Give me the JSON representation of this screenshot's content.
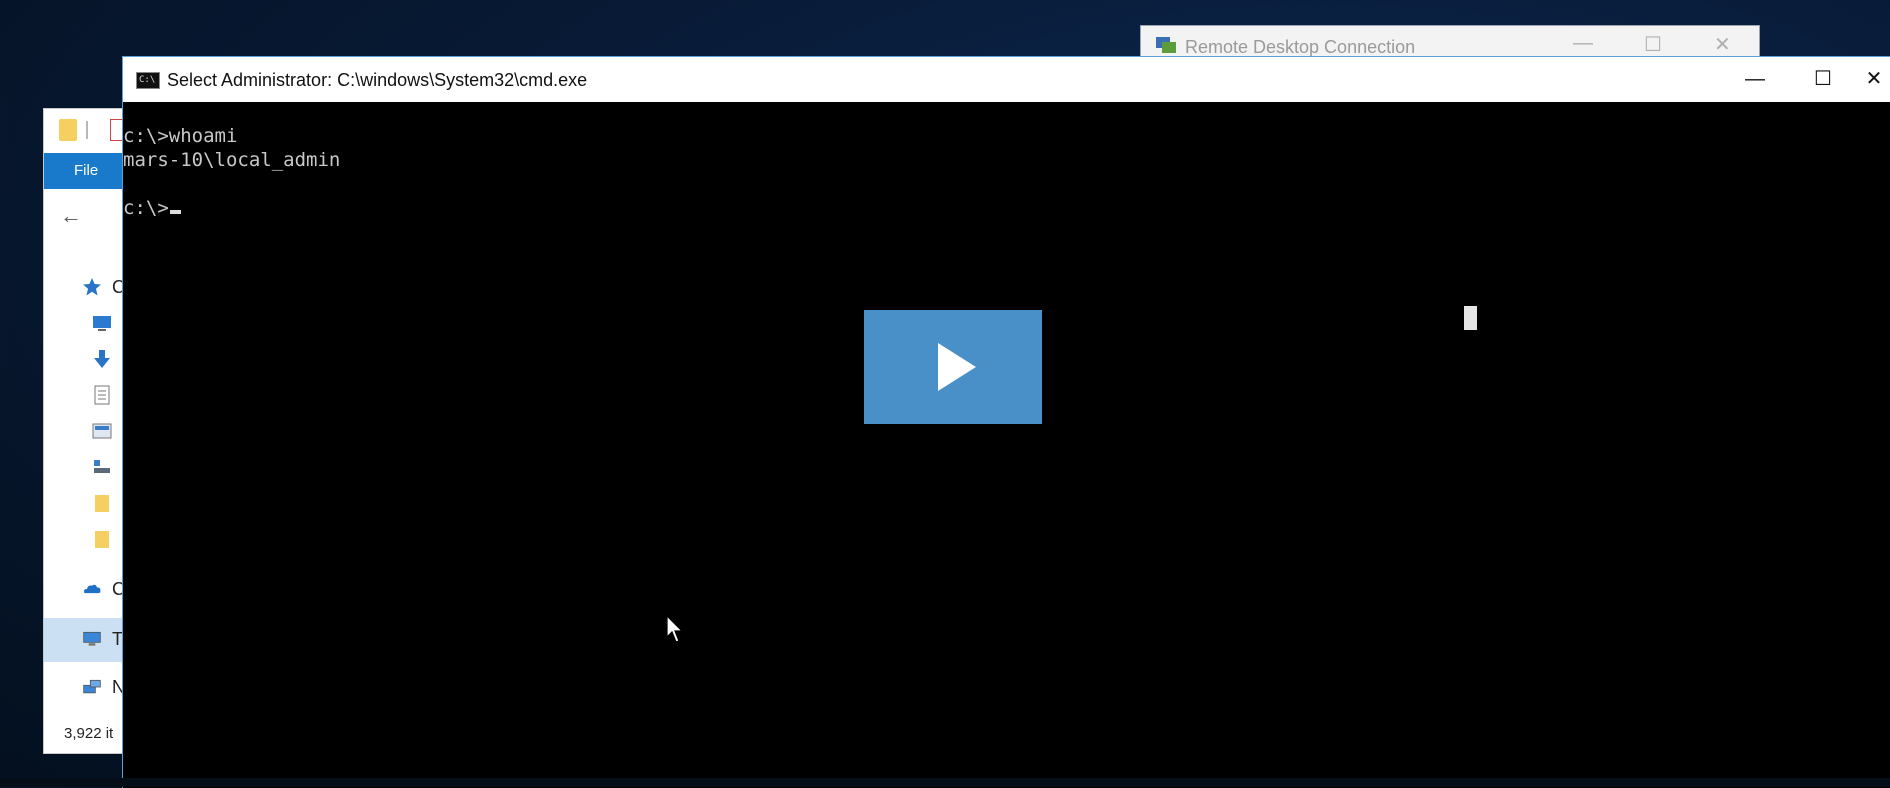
{
  "remote_desktop": {
    "title": "Remote Desktop Connection",
    "minimize": "—",
    "maximize": "☐",
    "close": "✕"
  },
  "explorer": {
    "ribbon_tab": "File",
    "back_arrow": "←",
    "nav_items": [
      {
        "icon": "quick-access-star-icon",
        "label": "C"
      },
      {
        "icon": "desktop-icon",
        "label": ""
      },
      {
        "icon": "downloads-icon",
        "label": ""
      },
      {
        "icon": "documents-icon",
        "label": ""
      },
      {
        "icon": "pictures-icon",
        "label": ""
      },
      {
        "icon": "network-drive-icon",
        "label": ""
      },
      {
        "icon": "folder-icon",
        "label": ""
      },
      {
        "icon": "folder-icon",
        "label": ""
      },
      {
        "icon": "onedrive-icon",
        "label": "C"
      },
      {
        "icon": "this-pc-icon",
        "label": "T"
      },
      {
        "icon": "network-icon",
        "label": "N"
      }
    ],
    "status": "3,922 it"
  },
  "cmd": {
    "title": "Select Administrator: C:\\windows\\System32\\cmd.exe",
    "icon_text": "C:\\",
    "minimize": "—",
    "maximize": "☐",
    "close": "✕",
    "lines": [
      "c:\\>whoami",
      "mars-10\\local_admin",
      "",
      "c:\\>"
    ]
  },
  "player": {
    "play_label": "Play video"
  },
  "colors": {
    "desktop_bg": "#0a2244",
    "play_button": "#4a90c8",
    "explorer_ribbon": "#1979ca",
    "cmd_border": "#5aa0dc"
  }
}
